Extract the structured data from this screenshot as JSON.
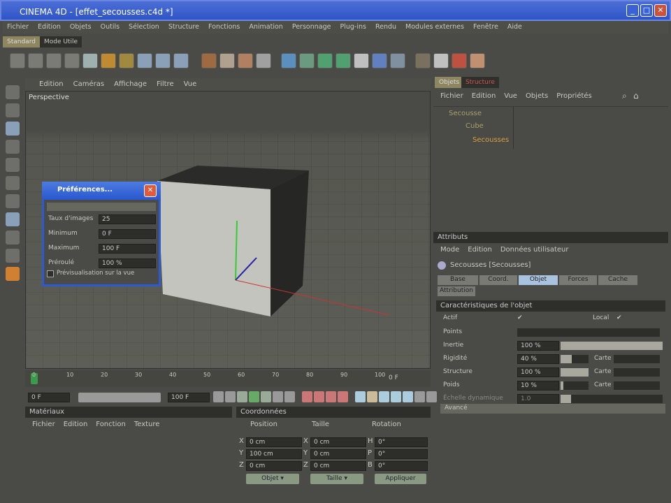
{
  "window": {
    "title": "CINEMA 4D - [effet_secousses.c4d *]",
    "minimize": "_",
    "maximize": "□",
    "close": "✕"
  },
  "menu": [
    "Fichier",
    "Edition",
    "Objets",
    "Outils",
    "Sélection",
    "Structure",
    "Fonctions",
    "Animation",
    "Personnage",
    "Plug-ins",
    "Rendu",
    "Modules externes",
    "Fenêtre",
    "Aide"
  ],
  "layout_tabs": [
    "Standard",
    "Mode Utile"
  ],
  "viewport": {
    "menu": [
      "Edition",
      "Caméras",
      "Affichage",
      "Filtre",
      "Vue"
    ],
    "label": "Perspective"
  },
  "object_manager": {
    "tabs": [
      "Objets",
      "Structure"
    ],
    "menu": [
      "Fichier",
      "Edition",
      "Vue",
      "Objets",
      "Propriétés"
    ],
    "items": [
      "Secousse",
      "Cube",
      "Secousses"
    ]
  },
  "attributes": {
    "title": "Attributs",
    "menu": [
      "Mode",
      "Edition",
      "Données utilisateur"
    ],
    "object": "Secousses [Secousses]",
    "tabs": [
      "Base",
      "Coord.",
      "Objet",
      "Forces",
      "Cache",
      "Attribution"
    ],
    "active_tab": "Objet",
    "section": "Caractéristiques de l'objet",
    "actif": "Actif",
    "local": "Local",
    "rows": [
      {
        "label": "Points",
        "value": ""
      },
      {
        "label": "Inertie",
        "value": "100 %",
        "fill": 100
      },
      {
        "label": "Rigidité",
        "value": "40 %",
        "fill": 40,
        "map": "Carte"
      },
      {
        "label": "Structure",
        "value": "100 %",
        "fill": 100,
        "map": "Carte"
      },
      {
        "label": "Poids",
        "value": "10 %",
        "fill": 10,
        "map": "Carte"
      },
      {
        "label": "Échelle dynamique",
        "value": "1.0"
      }
    ],
    "advanced": "Avancé"
  },
  "preferences": {
    "title": "Préférences...",
    "fields": [
      {
        "label": "Taux d'images",
        "value": "25"
      },
      {
        "label": "Minimum",
        "value": "0 F"
      },
      {
        "label": "Maximum",
        "value": "100 F"
      },
      {
        "label": "Préroulé",
        "value": "100 %"
      }
    ],
    "checkbox": "Prévisualisation sur la vue"
  },
  "timeline": {
    "ticks": [
      "0",
      "10",
      "20",
      "30",
      "40",
      "50",
      "60",
      "70",
      "80",
      "90",
      "100"
    ],
    "current": "0 F",
    "start": "0 F",
    "end": "100 F"
  },
  "materials": {
    "title": "Matériaux",
    "menu": [
      "Fichier",
      "Edition",
      "Fonction",
      "Texture"
    ]
  },
  "coordinates": {
    "title": "Coordonnées",
    "headers": [
      "Position",
      "Taille",
      "Rotation"
    ],
    "rows": [
      {
        "a": "X",
        "p": "0 cm",
        "s": "0 cm",
        "r": "H",
        "rv": "0°"
      },
      {
        "a": "Y",
        "p": "100 cm",
        "s": "0 cm",
        "r": "P",
        "rv": "0°"
      },
      {
        "a": "Z",
        "p": "0 cm",
        "s": "0 cm",
        "r": "B",
        "rv": "0°"
      }
    ],
    "mode": "Objet",
    "size_mode": "Taille",
    "apply": "Appliquer"
  },
  "colors": {
    "accent": "#2f54c6",
    "panel": "#4a4b46"
  }
}
